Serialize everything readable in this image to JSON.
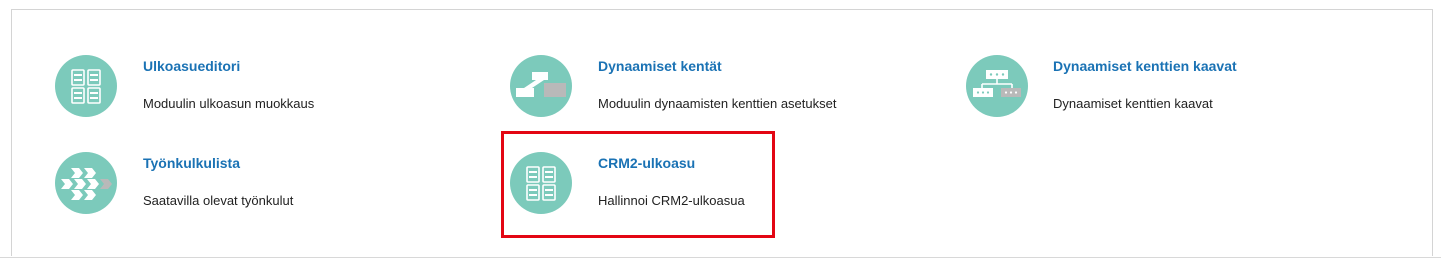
{
  "colors": {
    "accent": "#1a72b4",
    "icon_bg": "#7ccabb",
    "highlight": "#e30613"
  },
  "items": [
    {
      "title": "Ulkoasueditori",
      "description": "Moduulin ulkoasun muokkaus",
      "icon": "layout-editor-icon"
    },
    {
      "title": "Dynaamiset kentät",
      "description": "Moduulin dynaamisten kenttien asetukset",
      "icon": "dynamic-fields-icon"
    },
    {
      "title": "Dynaamiset kenttien kaavat",
      "description": "Dynaamiset kenttien kaavat",
      "icon": "dynamic-formulas-icon"
    },
    {
      "title": "Työnkulkulista",
      "description": "Saatavilla olevat työnkulut",
      "icon": "workflow-list-icon"
    },
    {
      "title": "CRM2-ulkoasu",
      "description": "Hallinnoi CRM2-ulkoasua",
      "icon": "crm2-layout-icon"
    }
  ]
}
